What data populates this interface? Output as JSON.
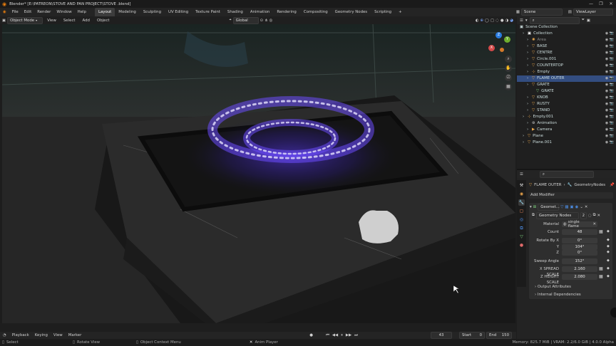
{
  "window": {
    "title": "Blender* [E:\\PATREON\\STOVE AND PAN PROJECT\\STOVE .blend]",
    "controls": [
      "—",
      "❐",
      "✕"
    ]
  },
  "menu": {
    "items": [
      "File",
      "Edit",
      "Render",
      "Window",
      "Help"
    ],
    "workspaces": [
      "Layout",
      "Modeling",
      "Sculpting",
      "UV Editing",
      "Texture Paint",
      "Shading",
      "Animation",
      "Rendering",
      "Compositing",
      "Geometry Nodes",
      "Scripting"
    ],
    "add_tab": "+",
    "scene": "Scene",
    "view_layer": "ViewLayer"
  },
  "viewport_header": {
    "mode": "Object Mode",
    "menus": [
      "View",
      "Select",
      "Add",
      "Object"
    ],
    "orientation": "Global"
  },
  "gizmo": {
    "x": "X",
    "y": "Y",
    "z": "Z"
  },
  "outliner": {
    "root": "Scene Collection",
    "rows": [
      {
        "label": "Collection",
        "indent": 1,
        "icon": "collection-icon",
        "color": "#ffffff"
      },
      {
        "label": "Area",
        "indent": 2,
        "icon": "light-icon",
        "color": "#e9a74b",
        "dim": true
      },
      {
        "label": "BASE",
        "indent": 2,
        "icon": "mesh-icon",
        "color": "#e9a74b"
      },
      {
        "label": "CENTRE",
        "indent": 2,
        "icon": "mesh-icon",
        "color": "#e9a74b"
      },
      {
        "label": "Circle.001",
        "indent": 2,
        "icon": "mesh-icon",
        "color": "#e9a74b"
      },
      {
        "label": "COUNTERTOP",
        "indent": 2,
        "icon": "mesh-icon",
        "color": "#e9a74b"
      },
      {
        "label": "Empty",
        "indent": 2,
        "icon": "empty-icon",
        "color": "#e9a74b"
      },
      {
        "label": "FLAME OUTER",
        "indent": 2,
        "icon": "mesh-icon",
        "color": "#e9a74b",
        "selected": true
      },
      {
        "label": "GRATE",
        "indent": 2,
        "icon": "mesh-icon",
        "color": "#e9a74b"
      },
      {
        "label": "GRATE",
        "indent": 3,
        "icon": "mesh-data-icon",
        "color": "#7fd27f"
      },
      {
        "label": "KNOB",
        "indent": 2,
        "icon": "mesh-icon",
        "color": "#e9a74b"
      },
      {
        "label": "RUSTY",
        "indent": 2,
        "icon": "mesh-icon",
        "color": "#e9a74b"
      },
      {
        "label": "STAND",
        "indent": 2,
        "icon": "mesh-icon",
        "color": "#e9a74b"
      },
      {
        "label": "Empty.001",
        "indent": 1,
        "icon": "empty-icon",
        "color": "#e9a74b"
      },
      {
        "label": "Animation",
        "indent": 2,
        "icon": "action-icon",
        "color": "#cccccc"
      },
      {
        "label": "Camera",
        "indent": 2,
        "icon": "camera-icon",
        "color": "#e9a74b"
      },
      {
        "label": "Plane",
        "indent": 1,
        "icon": "mesh-icon",
        "color": "#e9a74b"
      },
      {
        "label": "Plane.001",
        "indent": 1,
        "icon": "mesh-icon",
        "color": "#e9a74b"
      }
    ]
  },
  "properties": {
    "object": "FLAME OUTER",
    "modifier_tab": "GeometryNodes",
    "add_modifier": "Add Modifier",
    "modifier_name": "Geomet...",
    "node_group": "Geometry Nodes",
    "node_users": "2",
    "material_label": "Material",
    "material_value": "single flame",
    "fields": [
      {
        "label": "Count",
        "value": "48"
      },
      {
        "label": "Rotate By X",
        "value": "0°"
      },
      {
        "label": "Y",
        "value": "104°"
      },
      {
        "label": "Z",
        "value": "0°"
      },
      {
        "label": "Sweep Angle",
        "value": "152°"
      },
      {
        "label": "X SPREAD SCALE",
        "value": "2.160"
      },
      {
        "label": "Z HEIGHT SCALE",
        "value": "2.080"
      }
    ],
    "panels": [
      "Output Attributes",
      "Internal Dependencies"
    ]
  },
  "timeline": {
    "menus": [
      "Playback",
      "Keying",
      "View",
      "Marker"
    ],
    "current": "43",
    "start_label": "Start",
    "start": "0",
    "end_label": "End",
    "end": "150"
  },
  "status": {
    "select": "Select",
    "rotate": "Rotate View",
    "context": "Object Context Menu",
    "anim": "Anim Player",
    "memory": "Memory: 825.7 MiB | VRAM: 2.2/6.0 GiB | 4.0.0 Alpha"
  }
}
